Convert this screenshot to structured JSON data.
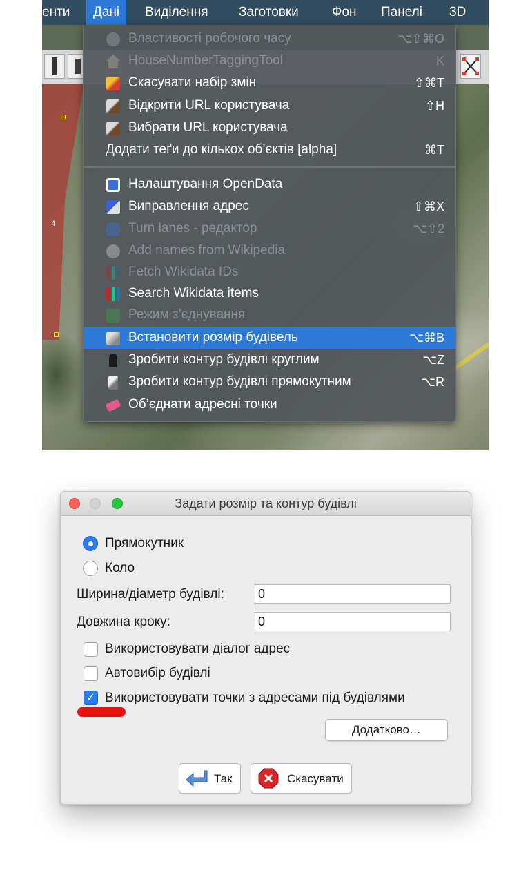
{
  "menubar": {
    "items": [
      "енти",
      "Дані",
      "Виділення",
      "Заготовки",
      "Фон",
      "Панелі",
      "3D"
    ],
    "active_index": 1
  },
  "map": {
    "polygon_label": "4"
  },
  "menu": {
    "items": [
      {
        "label": "Властивості робочого часу",
        "shortcut": "⌥⇧⌘O",
        "enabled": false,
        "icon": "clock-icon"
      },
      {
        "label": "HouseNumberTaggingTool",
        "shortcut": "K",
        "enabled": false,
        "icon": "house-icon"
      },
      {
        "label": "Скасувати набір змін",
        "shortcut": "⇧⌘T",
        "enabled": true,
        "icon": "revert-icon"
      },
      {
        "label": "Відкрити URL користувача",
        "shortcut": "⇧H",
        "enabled": true,
        "icon": "wrench-icon"
      },
      {
        "label": "Вибрати URL користувача",
        "shortcut": "",
        "enabled": true,
        "icon": "wrench-icon"
      },
      {
        "label": "Додати теґи до кількох об’єктів [alpha]",
        "shortcut": "⌘T",
        "enabled": true,
        "icon": ""
      },
      {
        "label": "Налаштування OpenData",
        "shortcut": "",
        "enabled": true,
        "icon": "opendata-icon"
      },
      {
        "label": "Виправлення адрес",
        "shortcut": "⇧⌘X",
        "enabled": true,
        "icon": "address-fix-icon"
      },
      {
        "label": "Turn lanes - редактор",
        "shortcut": "⌥⇧2",
        "enabled": false,
        "icon": "turn-lanes-icon"
      },
      {
        "label": "Add names from Wikipedia",
        "shortcut": "",
        "enabled": false,
        "icon": "wikipedia-icon"
      },
      {
        "label": "Fetch Wikidata IDs",
        "shortcut": "",
        "enabled": false,
        "icon": "wikidata-icon"
      },
      {
        "label": "Search Wikidata items",
        "shortcut": "",
        "enabled": true,
        "icon": "wikidata-icon"
      },
      {
        "label": "Режим з’єднування",
        "shortcut": "",
        "enabled": false,
        "icon": "connect-icon"
      },
      {
        "label": "Встановити розмір будівель",
        "shortcut": "⌥⌘B",
        "enabled": true,
        "icon": "building-size-icon",
        "highlighted": true
      },
      {
        "label": "Зробити контур будівлі круглим",
        "shortcut": "⌥Z",
        "enabled": true,
        "icon": "round-building-icon"
      },
      {
        "label": "Зробити контур будівлі прямокутним",
        "shortcut": "⌥R",
        "enabled": true,
        "icon": "rect-building-icon"
      },
      {
        "label": "Об’єднати адресні точки",
        "shortcut": "",
        "enabled": true,
        "icon": "merge-address-icon"
      }
    ]
  },
  "dialog": {
    "title": "Задати розмір та контур будівлі",
    "radio_rect": "Прямокутник",
    "radio_circle": "Коло",
    "selected_shape": "Прямокутник",
    "width_label": "Ширина/діаметр будівлі:",
    "width_value": "0",
    "step_label": "Довжина кроку:",
    "step_value": "0",
    "cb_address_dialog": "Використовувати діалог адрес",
    "cb_address_dialog_checked": false,
    "cb_autoselect": "Автовибір будівлі",
    "cb_autoselect_checked": false,
    "cb_address_points": "Використовувати точки з адресами під будівлями",
    "cb_address_points_checked": true,
    "advanced_button": "Додатково…",
    "ok_button": "Так",
    "cancel_button": "Скасувати"
  },
  "colors": {
    "menubar_bg": "#324d60",
    "highlight": "#2c79d8",
    "accent_blue": "#2b7cf0",
    "annotation_red": "#e8100f"
  }
}
